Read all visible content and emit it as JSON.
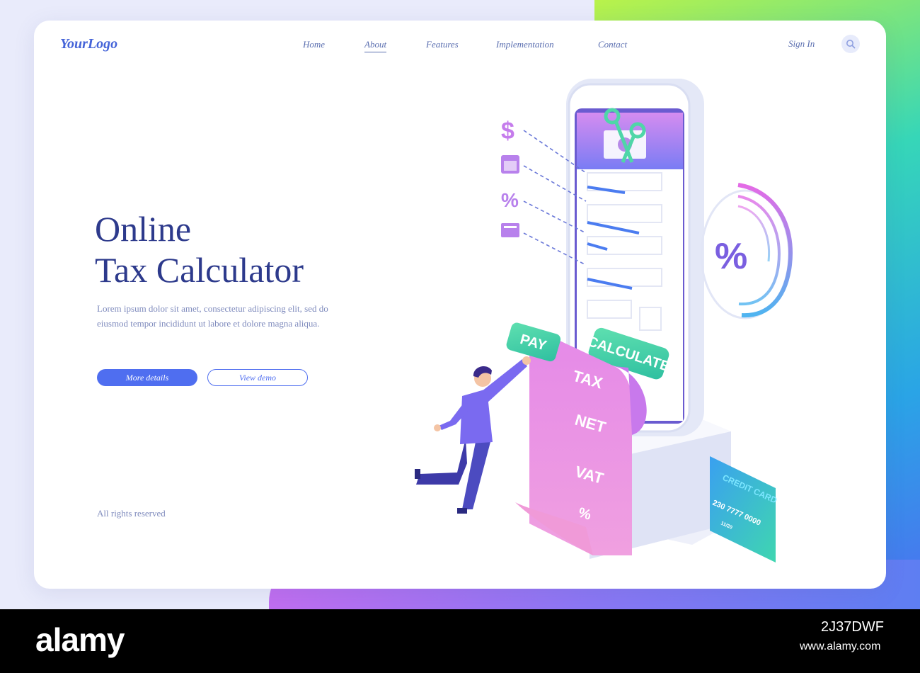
{
  "header": {
    "logo": "YourLogo",
    "nav": [
      {
        "label": "Home"
      },
      {
        "label": "About"
      },
      {
        "label": "Features"
      },
      {
        "label": "Implementation"
      },
      {
        "label": "Contact"
      }
    ],
    "active_nav": "About",
    "sign_in": "Sign In",
    "search_icon": "search-icon"
  },
  "hero": {
    "title_line1": "Online",
    "title_line2": "Tax Calculator",
    "description": "Lorem ipsum dolor sit amet, consectetur adipiscing elit, sed do eiusmod tempor incididunt ut labore et dolore magna aliqua.",
    "primary_button": "More details",
    "secondary_button": "View demo"
  },
  "footer": {
    "copyright": "All rights reserved"
  },
  "illustration": {
    "pay_label": "PAY",
    "calculate_label": "CALCULATE",
    "receipt_items": [
      "TAX",
      "NET",
      "VAT",
      "%"
    ],
    "credit_card_label": "CREDIT CARD",
    "card_number": "230 7777 0000",
    "card_expiry": "11/20",
    "percent_symbol": "%",
    "side_icons": [
      "dollar-icon",
      "calendar-icon",
      "percent-icon",
      "card-icon"
    ]
  },
  "watermark": {
    "brand": "alamy",
    "image_id": "2J37DWF",
    "url": "www.alamy.com"
  },
  "colors": {
    "accent": "#4f6ef0",
    "title": "#2d3a8c",
    "text_muted": "#7f8bbd",
    "pink": "#e77be6",
    "teal": "#3ed6a8"
  }
}
